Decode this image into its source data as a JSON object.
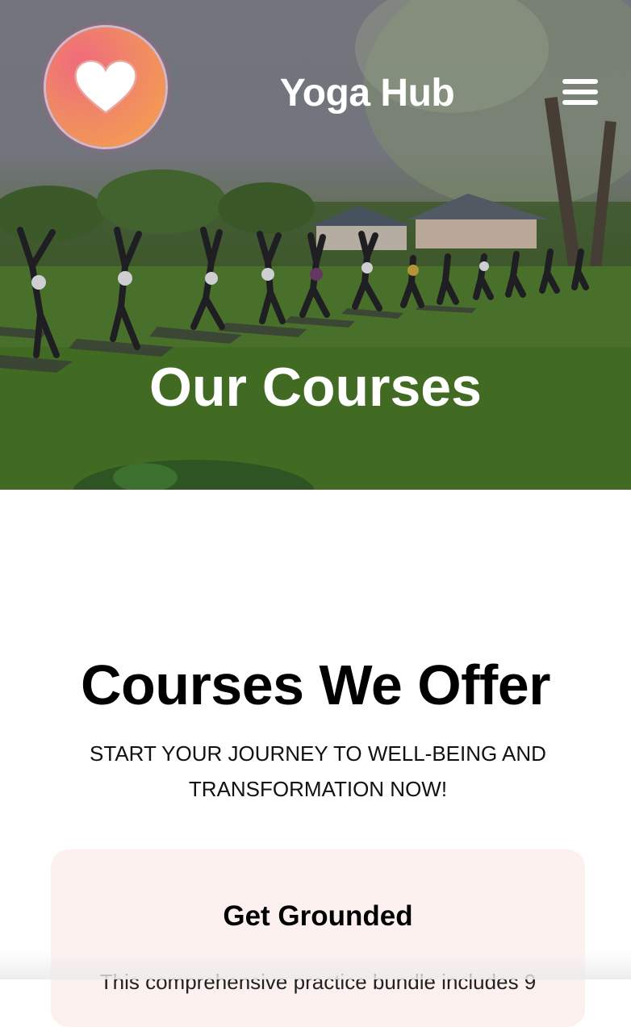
{
  "header": {
    "brand": "Yoga Hub",
    "logo_icon": "heart-icon",
    "menu_icon": "hamburger-menu-icon"
  },
  "hero": {
    "title": "Our Courses",
    "image": "outdoor-group-yoga-class-on-lawn"
  },
  "courses": {
    "title": "Courses We Offer",
    "subtitle": "START YOUR JOURNEY TO WELL-BEING AND TRANSFORMATION NOW!",
    "items": [
      {
        "title": "Get Grounded",
        "description": "This comprehensive practice bundle includes 9"
      }
    ]
  },
  "colors": {
    "logo_gradient_start": "#f06a7c",
    "logo_gradient_end": "#f6a24a",
    "card_background": "#fdf1f0",
    "text": "#000000",
    "hero_text": "#ffffff"
  }
}
